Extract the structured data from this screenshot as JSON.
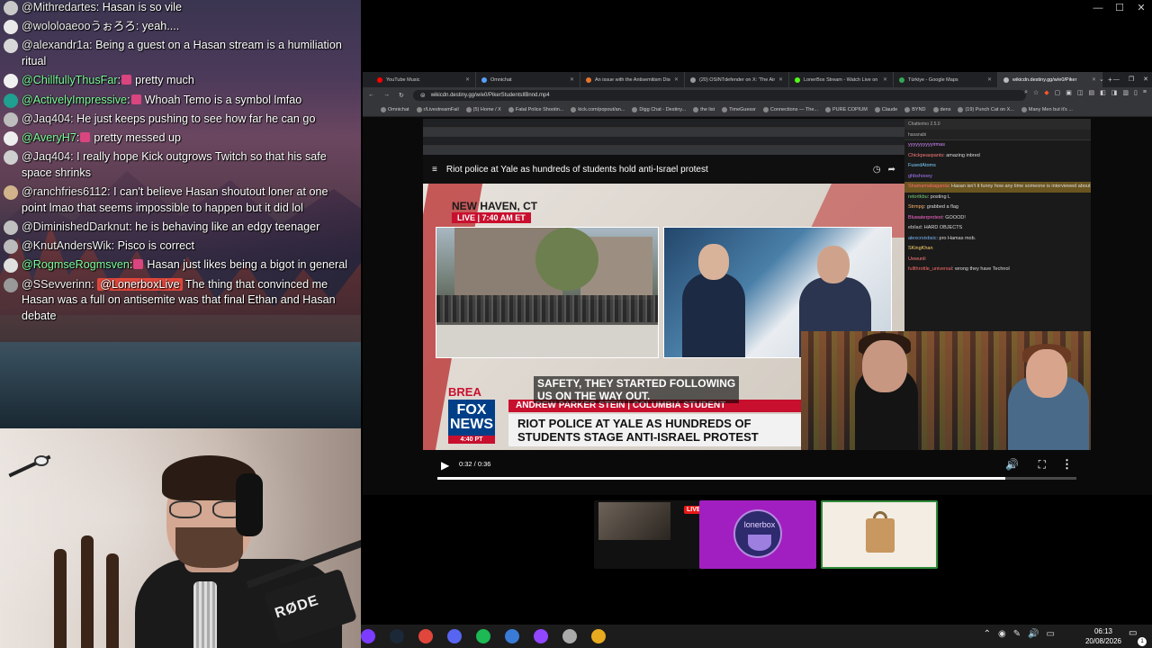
{
  "chat": {
    "messages": [
      {
        "user": "@Mithredartes",
        "text": ": Hasan is so vile",
        "user_color": "white",
        "badge": false
      },
      {
        "user": "@wololoaeoo",
        "suffix": "うぉろろ",
        "text": ": yeah....",
        "user_color": "white",
        "badge": false
      },
      {
        "user": "@alexandr1a",
        "text": ": Being a guest on a Hasan stream is a humiliation ritual",
        "user_color": "white",
        "badge": false
      },
      {
        "user": "@ChillfullyThusFar",
        "text": ": pretty much",
        "user_color": "green",
        "badge": true
      },
      {
        "user": "@ActivelyImpressive",
        "text": ": Whoah Temo is a symbol lmfao",
        "user_color": "green",
        "badge": true
      },
      {
        "user": "@Jaq404",
        "text": ": He just keeps pushing to see how far he can go",
        "user_color": "white",
        "badge": false
      },
      {
        "user": "@AveryH7",
        "text": ": pretty messed up",
        "user_color": "green",
        "badge": true
      },
      {
        "user": "@Jaq404",
        "text": ": I really hope Kick outgrows Twitch so that his safe space shrinks",
        "user_color": "white",
        "badge": false
      },
      {
        "user": "@ranchfries6112",
        "text": ": I can't believe Hasan shoutout loner at one point lmao that seems impossible to happen but it did lol",
        "user_color": "white",
        "badge": false
      },
      {
        "user": "@DiminishedDarknut",
        "text": ": he is behaving like an edgy teenager",
        "user_color": "white",
        "badge": false
      },
      {
        "user": "@KnutAndersWik",
        "text": ": Pisco is correct",
        "user_color": "white",
        "badge": false
      },
      {
        "user": "@RogmseRogmsven",
        "text": ": Hasan just likes being a bigot in general",
        "user_color": "green",
        "badge": true
      },
      {
        "user": "@SSevverinn",
        "mention": "@LonerboxLive",
        "text": " The thing that convinced me Hasan was a full on antisemite was that final Ethan and Hasan debate",
        "user_color": "white",
        "badge": false
      }
    ],
    "colors": {
      "green": "#7cfc9a",
      "white": "#f0f0f0",
      "mention_bg": "#e0463b"
    }
  },
  "webcam": {
    "mic_brand": "RØDE"
  },
  "window_controls": [
    "—",
    "☐",
    "✕"
  ],
  "browser": {
    "tabs": [
      {
        "label": "YouTube Music",
        "color": "#ff0000",
        "active": false
      },
      {
        "label": "Omnichat",
        "color": "#5aa0ff",
        "active": false
      },
      {
        "label": "An issue with the Antisemitism Disc",
        "color": "#e8742a",
        "active": false
      },
      {
        "label": "(20) OSINTdefender on X: 'The Air I'",
        "color": "#999999",
        "active": false
      },
      {
        "label": "LonerBox Stream - Watch Live on I",
        "color": "#53fc18",
        "active": false
      },
      {
        "label": "Türkiye - Google Maps",
        "color": "#34a853",
        "active": false
      },
      {
        "label": "wikicdn.destiny.gg/w/e0/Piker",
        "color": "#bbbbbb",
        "active": true
      }
    ],
    "new_tab": "+",
    "url": "wikicdn.destiny.gg/w/e0/PikerStudentsIlBnnd.mp4",
    "bookmarks": [
      "Omnichat",
      "r/LivestreamFail",
      "(5) Home / X",
      "Fatal Police Shootin...",
      "kick.com/popout/an...",
      "Digg Chat - Destiny...",
      "the list",
      "TimeGuessr",
      "Connections — The...",
      "PURE COPIUM",
      "Claude",
      "BYND",
      "dens",
      "(19) Punch Cat on X...",
      "Many Men but it's ..."
    ]
  },
  "video": {
    "title": "Riot police at Yale as hundreds of students hold anti-Israel protest",
    "location": "NEW HAVEN, CT",
    "live_badge": "LIVE | 7:40 AM ET",
    "break_text": "BREA",
    "name_bar": "ANDREW PARKER STEIN | COLUMBIA STUDENT",
    "headline": "RIOT POLICE AT YALE AS HUNDREDS OF STUDENTS STAGE ANTI-ISRAEL PROTEST",
    "logo_text": "FOX NEWS",
    "logo_time": "4:40 PT",
    "subtitle_line1": "SAFETY, THEY STARTED FOLLOWING",
    "subtitle_line2": "US ON THE WAY OUT.",
    "time": "0:32 / 0:36",
    "progress": 0.889
  },
  "embedded_chat": {
    "header": "Chatterino 2.5.0",
    "channel": "hasanabi",
    "lines": [
      {
        "user": "yyyyyyyyyyirmas",
        "text": "",
        "color": "#d48aff"
      },
      {
        "user": "Chickpeaspants",
        "text": "amazing inbred",
        "color": "#ff7a7a"
      },
      {
        "user": "FusedAtoms",
        "text": "",
        "color": "#7ad1ff"
      },
      {
        "user": "ghbshooey",
        "text": "",
        "color": "#a97aff"
      },
      {
        "user": "Shamamabaganta",
        "text": "Hasan isn't it funny how any time someone is interviewed about how violent their protestors are, it's always people who have ALMOST been hurt",
        "color": "#ff6b6b",
        "hl": true
      },
      {
        "user": "retortkbu",
        "text": "posting L",
        "color": "#7ad17a"
      },
      {
        "user": "Strmpg",
        "text": "grabbed a flag",
        "color": "#ffb36b"
      },
      {
        "user": "Bluwaterprotest",
        "text": "GOOOD!",
        "color": "#ff6bd1"
      },
      {
        "user": "ebilad",
        "text": "HARD OBJECTS",
        "color": "#cccccc"
      },
      {
        "user": "alexcroixbsic",
        "text": "pro Hamas mob.",
        "color": "#7ab8ff"
      },
      {
        "user": "SKingKhan",
        "text": "",
        "color": "#ffd36b"
      },
      {
        "user": "Uewunli",
        "text": "",
        "color": "#ff7a7a"
      },
      {
        "user": "fullthrottle_universal",
        "text": "wrong they have Technol",
        "color": "#ff6b6b"
      }
    ]
  },
  "thumbnails": {
    "live_label": "LIVE",
    "lonerbox_label": "lonerbox"
  },
  "taskbar": {
    "time": "06:13",
    "date": "20/08/2026",
    "notifications": "1",
    "tray": [
      "⌃",
      "◉",
      "✎",
      "🔊",
      "▭"
    ],
    "app_colors": [
      "#7b3cff",
      "#1b2838",
      "#e0463b",
      "#5865f2",
      "#1db954",
      "#3a7bd5",
      "#9146ff",
      "#aaaaaa",
      "#e8aa1e"
    ]
  }
}
